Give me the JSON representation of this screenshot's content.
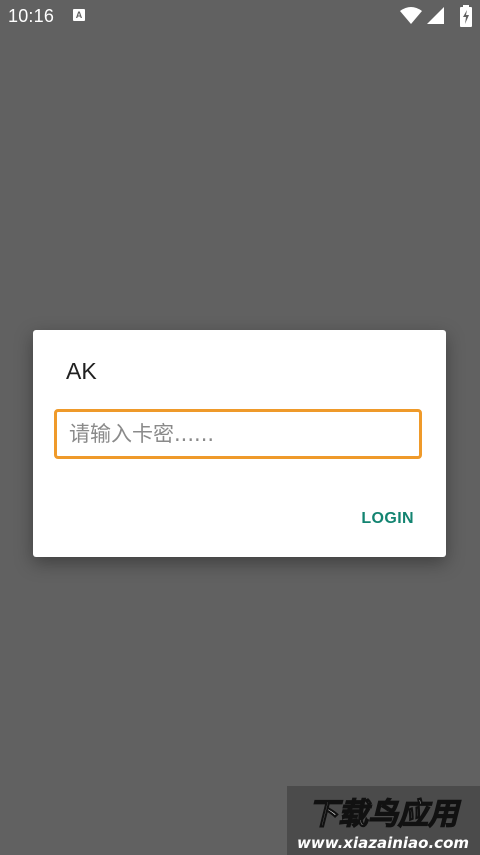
{
  "status_bar": {
    "time": "10:16",
    "notification_glyph": "A",
    "icons": [
      "wifi-icon",
      "cell-signal-icon",
      "battery-charging-icon"
    ]
  },
  "dialog": {
    "title": "AK",
    "input": {
      "value": "",
      "placeholder": "请输入卡密......"
    },
    "login_label": "LOGIN"
  },
  "watermark": {
    "brand": "下载鸟应用",
    "url": "www.xiazainiao.com"
  },
  "colors": {
    "background_dim": "#616161",
    "accent_input_border": "#ef9a2a",
    "button_text": "#138471"
  }
}
